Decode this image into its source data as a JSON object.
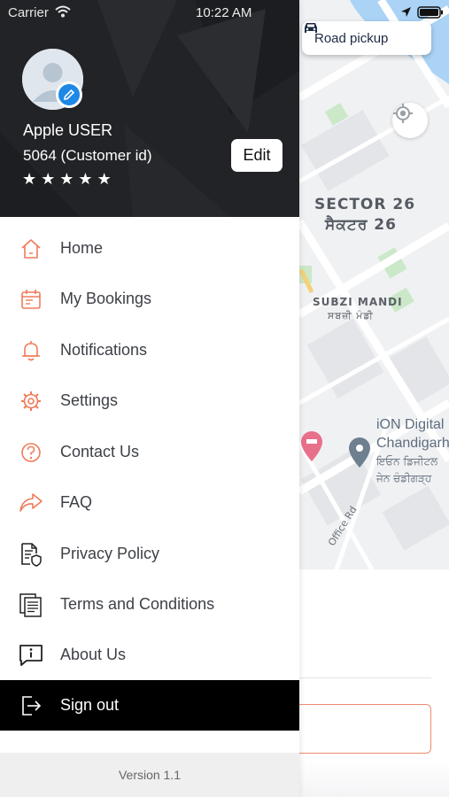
{
  "status_bar": {
    "carrier": "Carrier",
    "time": "10:22 AM"
  },
  "map": {
    "sector_label": "SECTOR 26",
    "sector_label_pa": "ਸੈਕਟਰ 26",
    "market_label": "SUBZI MANDI",
    "market_label_pa": "ਸਬਜ਼ੀ ਮੰਡੀ",
    "poi_name_line1": "iON Digital",
    "poi_name_line2": "Chandigarh",
    "poi_name_pa_line1": "ਇਓਨ ਡਿਜੀਟਲ",
    "poi_name_pa_line2": "ਜੇਨ ਚੰਡੀਗੜ੍ਹ",
    "road_label": "Office Rd",
    "road_pickup_label": "Road pickup"
  },
  "drawer": {
    "user_name": "Apple USER",
    "customer_id": "5064 (Customer id)",
    "rating_stars": 5,
    "star_glyph": "★",
    "edit_label": "Edit",
    "menu": [
      {
        "label": "Home",
        "icon": "home-icon"
      },
      {
        "label": "My Bookings",
        "icon": "calendar-icon"
      },
      {
        "label": "Notifications",
        "icon": "bell-icon"
      },
      {
        "label": "Settings",
        "icon": "gear-icon"
      },
      {
        "label": "Contact Us",
        "icon": "question-icon"
      },
      {
        "label": "FAQ",
        "icon": "share-arrow-icon"
      },
      {
        "label": "Privacy Policy",
        "icon": "document-shield-icon"
      },
      {
        "label": "Terms and Conditions",
        "icon": "documents-icon"
      },
      {
        "label": "About Us",
        "icon": "info-message-icon"
      }
    ],
    "sign_out_label": "Sign out",
    "version": "Version 1.1"
  },
  "colors": {
    "accent": "#f07b5a",
    "header_bg": "#222326",
    "signout_bg": "#000000",
    "edit_badge": "#1e88e5"
  }
}
